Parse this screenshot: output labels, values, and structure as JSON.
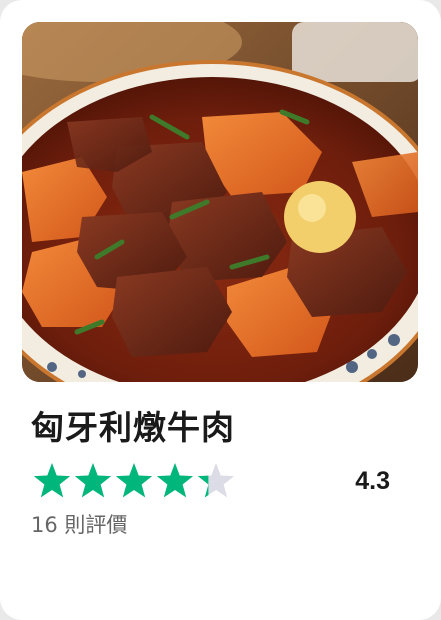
{
  "recipe": {
    "title": "匈牙利燉牛肉",
    "rating": "4.3",
    "rating_fraction": 0.86,
    "stars_total": 5,
    "review_count_text": "16 則評價"
  },
  "colors": {
    "star_filled": "#00b67a",
    "star_empty": "#dcdce6",
    "title": "#1a1a1a",
    "reviews": "#666666"
  },
  "icons": {
    "rating": "star-icon"
  }
}
